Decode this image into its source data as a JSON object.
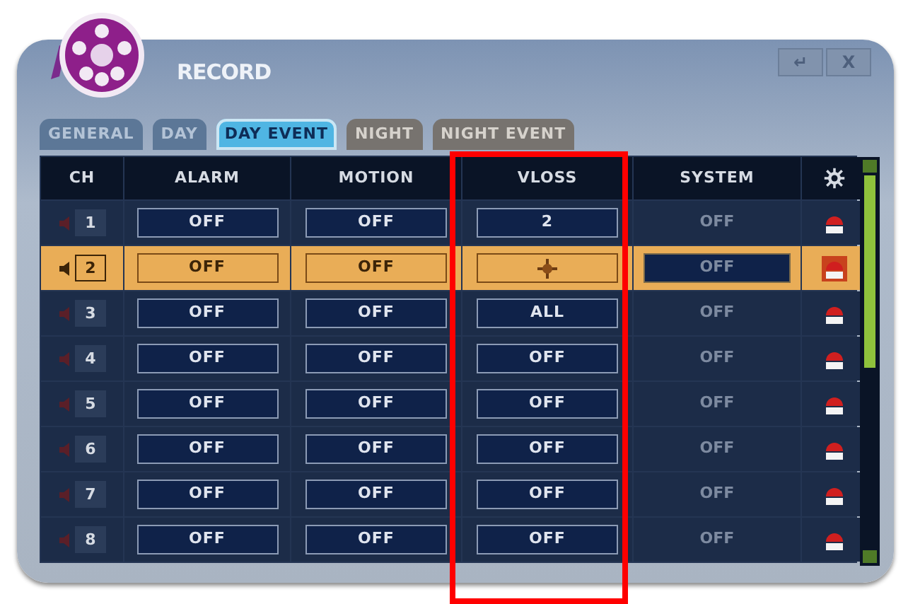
{
  "window": {
    "title": "RECORD"
  },
  "title_buttons": [
    {
      "label": "↵"
    },
    {
      "label": "X"
    }
  ],
  "tabs": [
    {
      "label": "GENERAL",
      "selected": false,
      "disabled": false
    },
    {
      "label": "DAY",
      "selected": false,
      "disabled": false
    },
    {
      "label": "DAY EVENT",
      "selected": true,
      "disabled": false
    },
    {
      "label": "NIGHT",
      "selected": false,
      "disabled": true
    },
    {
      "label": "NIGHT EVENT",
      "selected": false,
      "disabled": true
    }
  ],
  "table": {
    "columns": [
      "CH",
      "ALARM",
      "MOTION",
      "VLOSS",
      "SYSTEM"
    ],
    "rows": [
      {
        "ch": "1",
        "selected": false,
        "alarm": "OFF",
        "motion": "OFF",
        "vloss": {
          "kind": "text",
          "value": "2"
        },
        "system": "OFF",
        "system_disabled": true
      },
      {
        "ch": "2",
        "selected": true,
        "alarm": "OFF",
        "motion": "OFF",
        "vloss": {
          "kind": "cursor"
        },
        "system": "OFF",
        "system_disabled": true
      },
      {
        "ch": "3",
        "selected": false,
        "alarm": "OFF",
        "motion": "OFF",
        "vloss": {
          "kind": "text",
          "value": "ALL"
        },
        "system": "OFF",
        "system_disabled": true
      },
      {
        "ch": "4",
        "selected": false,
        "alarm": "OFF",
        "motion": "OFF",
        "vloss": {
          "kind": "text",
          "value": "OFF"
        },
        "system": "OFF",
        "system_disabled": true
      },
      {
        "ch": "5",
        "selected": false,
        "alarm": "OFF",
        "motion": "OFF",
        "vloss": {
          "kind": "text",
          "value": "OFF"
        },
        "system": "OFF",
        "system_disabled": true
      },
      {
        "ch": "6",
        "selected": false,
        "alarm": "OFF",
        "motion": "OFF",
        "vloss": {
          "kind": "text",
          "value": "OFF"
        },
        "system": "OFF",
        "system_disabled": true
      },
      {
        "ch": "7",
        "selected": false,
        "alarm": "OFF",
        "motion": "OFF",
        "vloss": {
          "kind": "text",
          "value": "OFF"
        },
        "system": "OFF",
        "system_disabled": true
      },
      {
        "ch": "8",
        "selected": false,
        "alarm": "OFF",
        "motion": "OFF",
        "vloss": {
          "kind": "text",
          "value": "OFF"
        },
        "system": "OFF",
        "system_disabled": true
      }
    ]
  }
}
